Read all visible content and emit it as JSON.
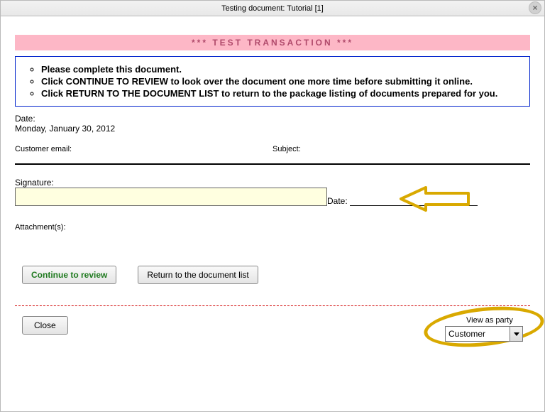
{
  "window": {
    "title": "Testing document: Tutorial [1]",
    "close_icon": "×"
  },
  "banner": "***  TEST TRANSACTION  ***",
  "instructions": {
    "items": [
      "Please complete this document.",
      "Click CONTINUE TO REVIEW to look over the document one more time before submitting it online.",
      "Click RETURN TO THE DOCUMENT LIST to return to the package listing of documents prepared for you."
    ]
  },
  "form": {
    "date_label": "Date:",
    "date_value": "Monday, January 30, 2012",
    "customer_email_label": "Customer email:",
    "subject_label": "Subject:",
    "signature_label": "Signature:",
    "date2_label": "Date:",
    "attachments_label": "Attachment(s):"
  },
  "buttons": {
    "continue": "Continue to review",
    "return": "Return to the document list",
    "close": "Close"
  },
  "viewas": {
    "label": "View as party",
    "selected": "Customer"
  }
}
